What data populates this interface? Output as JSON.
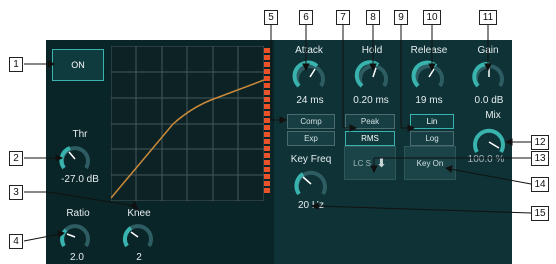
{
  "onButton": {
    "label": "ON"
  },
  "knobs": {
    "thr": {
      "label": "Thr",
      "value": "-27.0 dB"
    },
    "ratio": {
      "label": "Ratio",
      "value": "2.0"
    },
    "knee": {
      "label": "Knee",
      "value": "2"
    },
    "attack": {
      "label": "Attack",
      "value": "24 ms"
    },
    "hold": {
      "label": "Hold",
      "value": "0.20 ms"
    },
    "release": {
      "label": "Release",
      "value": "19 ms"
    },
    "gain": {
      "label": "Gain",
      "value": "0.0 dB"
    },
    "mix": {
      "label": "Mix",
      "value": "100.0 %"
    },
    "keyfreq": {
      "label": "Key Freq",
      "value": "20 Hz"
    }
  },
  "modeButtons": {
    "comp": "Comp",
    "exp": "Exp",
    "peak": "Peak",
    "rms": "RMS",
    "lin": "Lin",
    "log": "Log"
  },
  "keySource": {
    "label": "LC S"
  },
  "keyOn": {
    "label": "Key On"
  },
  "callouts": [
    "1",
    "2",
    "3",
    "4",
    "5",
    "6",
    "7",
    "8",
    "9",
    "10",
    "11",
    "12",
    "13",
    "14",
    "15"
  ],
  "colors": {
    "accent": "#39b3ad",
    "curve": "#c98a3a",
    "meter": "#e8532a"
  }
}
